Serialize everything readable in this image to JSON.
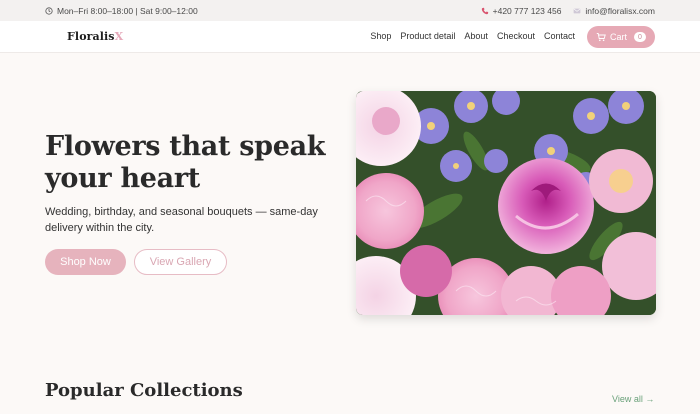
{
  "topbar": {
    "hours": "Mon–Fri 8:00–18:00 | Sat 9:00–12:00",
    "phone": "+420 777 123 456",
    "email": "info@floralisx.com"
  },
  "brand": {
    "name": "Floralis",
    "accent": "X"
  },
  "nav": {
    "items": [
      "Shop",
      "Product detail",
      "About",
      "Checkout",
      "Contact"
    ],
    "cart_label": "Cart",
    "cart_count": "0"
  },
  "hero": {
    "title": "Flowers that speak your heart",
    "subtitle": "Wedding, birthday, and seasonal bouquets — same-day delivery within the city.",
    "primary_cta": "Shop Now",
    "secondary_cta": "View Gallery"
  },
  "collections": {
    "title": "Popular Collections",
    "view_all": "View all →"
  },
  "colors": {
    "accent_pink": "#e6a9b5",
    "link_green": "#6aa17a",
    "background": "#fcf9f7"
  },
  "icons": {
    "hours": "clock-icon",
    "phone": "phone-icon",
    "email": "mail-icon",
    "cart": "cart-icon"
  }
}
